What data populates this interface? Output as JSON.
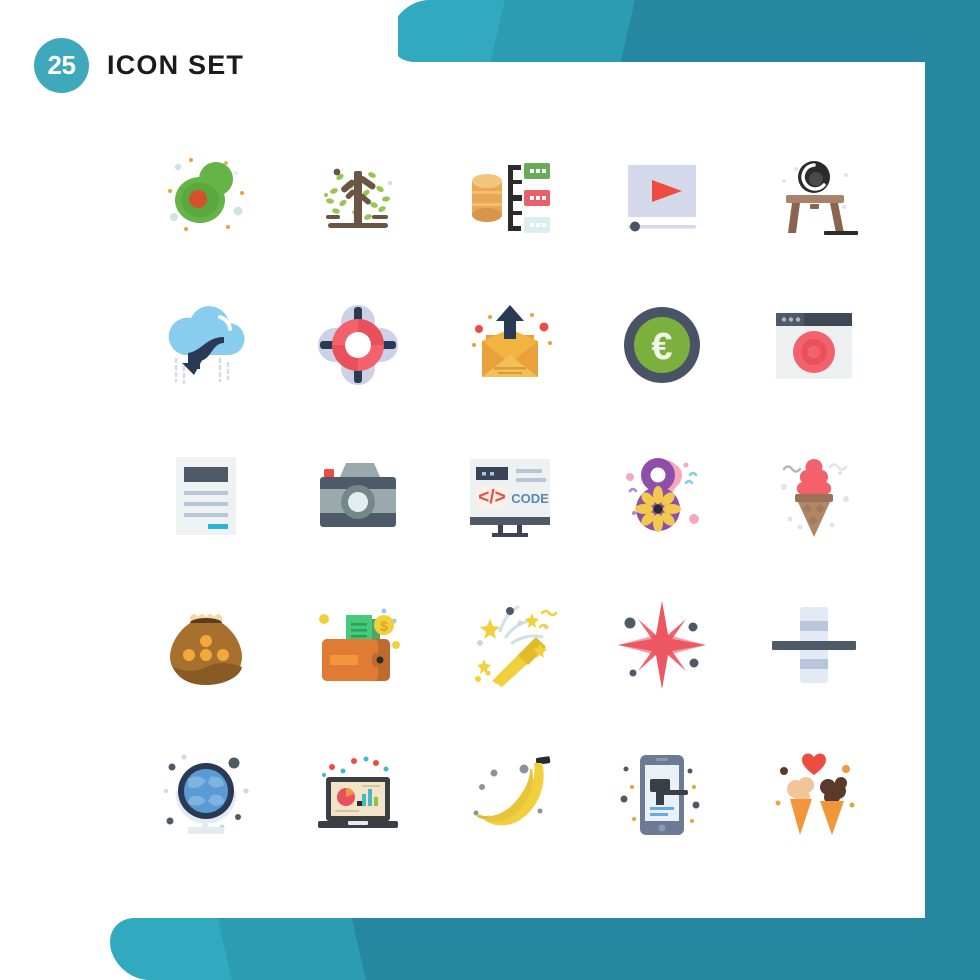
{
  "header": {
    "count": "25",
    "title": "ICON SET"
  },
  "theme": {
    "teal_light": "#31A9BF",
    "teal_mid": "#2C9CB3",
    "teal_dark": "#2688A0",
    "badge": "#3FA9BC",
    "background": "#FFFFFF",
    "title_color": "#1B1B1B"
  },
  "grid": {
    "columns": 5,
    "rows": 5,
    "total": 25
  },
  "icons": [
    {
      "id": 1,
      "name": "avocado-icon",
      "label": "Avocado",
      "row": 1,
      "col": 1
    },
    {
      "id": 2,
      "name": "tree-icon",
      "label": "Tree",
      "row": 1,
      "col": 2
    },
    {
      "id": 3,
      "name": "database-server-icon",
      "label": "Database Server",
      "row": 1,
      "col": 3
    },
    {
      "id": 4,
      "name": "video-player-icon",
      "label": "Video Player",
      "row": 1,
      "col": 4
    },
    {
      "id": 5,
      "name": "webcam-desk-icon",
      "label": "Webcam Desk",
      "row": 1,
      "col": 5
    },
    {
      "id": 6,
      "name": "cloud-download-icon",
      "label": "Cloud Download",
      "row": 2,
      "col": 1
    },
    {
      "id": 7,
      "name": "lifebuoy-support-icon",
      "label": "Support Lifebuoy",
      "row": 2,
      "col": 2
    },
    {
      "id": 8,
      "name": "send-email-icon",
      "label": "Send Email",
      "row": 2,
      "col": 3
    },
    {
      "id": 9,
      "name": "euro-coin-icon",
      "label": "Euro Coin",
      "row": 2,
      "col": 4
    },
    {
      "id": 10,
      "name": "browser-target-icon",
      "label": "Browser Target",
      "row": 2,
      "col": 5
    },
    {
      "id": 11,
      "name": "document-text-icon",
      "label": "Document",
      "row": 3,
      "col": 1
    },
    {
      "id": 12,
      "name": "camera-icon",
      "label": "Camera",
      "row": 3,
      "col": 2
    },
    {
      "id": 13,
      "name": "code-presentation-icon",
      "label": "Code Presentation",
      "row": 3,
      "col": 3,
      "text": "CODE"
    },
    {
      "id": 14,
      "name": "womens-day-icon",
      "label": "Womens Day",
      "row": 3,
      "col": 4,
      "text": "8"
    },
    {
      "id": 15,
      "name": "ice-cream-cone-icon",
      "label": "Ice Cream Cone",
      "row": 3,
      "col": 5
    },
    {
      "id": 16,
      "name": "clay-pot-icon",
      "label": "Clay Pot",
      "row": 4,
      "col": 1
    },
    {
      "id": 17,
      "name": "wallet-money-icon",
      "label": "Wallet With Money",
      "row": 4,
      "col": 2
    },
    {
      "id": 18,
      "name": "party-popper-icon",
      "label": "Party Popper",
      "row": 4,
      "col": 3
    },
    {
      "id": 19,
      "name": "sparkle-star-icon",
      "label": "Sparkle Star",
      "row": 4,
      "col": 4
    },
    {
      "id": 20,
      "name": "align-center-icon",
      "label": "Align Center",
      "row": 4,
      "col": 5
    },
    {
      "id": 21,
      "name": "globe-stand-icon",
      "label": "Globe",
      "row": 5,
      "col": 1
    },
    {
      "id": 22,
      "name": "laptop-analytics-icon",
      "label": "Laptop Analytics",
      "row": 5,
      "col": 2
    },
    {
      "id": 23,
      "name": "banana-icon",
      "label": "Banana",
      "row": 5,
      "col": 3
    },
    {
      "id": 24,
      "name": "mobile-auction-icon",
      "label": "Mobile Auction",
      "row": 5,
      "col": 4
    },
    {
      "id": 25,
      "name": "ice-cream-love-icon",
      "label": "Ice Cream Love",
      "row": 5,
      "col": 5
    }
  ]
}
